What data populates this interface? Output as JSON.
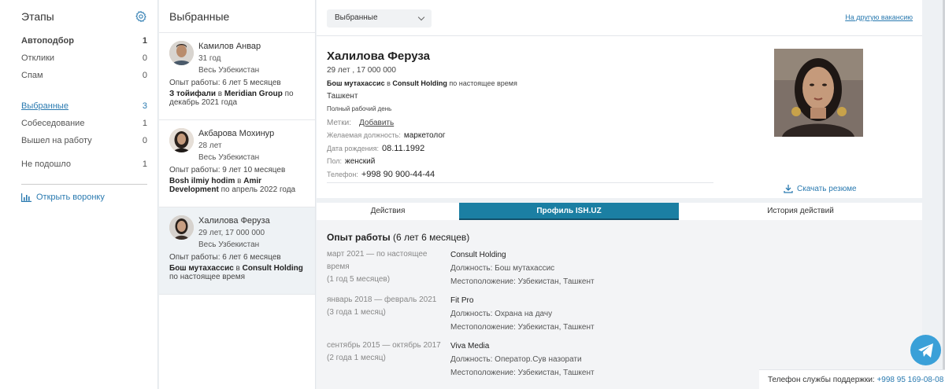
{
  "stages": {
    "title": "Этапы",
    "items": [
      {
        "label": "Автоподбор",
        "count": "1"
      },
      {
        "label": "Отклики",
        "count": "0"
      },
      {
        "label": "Спам",
        "count": "0"
      },
      {
        "label": "Выбранные",
        "count": "3"
      },
      {
        "label": "Собеседование",
        "count": "1"
      },
      {
        "label": "Вышел на работу",
        "count": "0"
      },
      {
        "label": "Не подошло",
        "count": "1"
      }
    ],
    "funnel_label": "Открыть воронку"
  },
  "selected": {
    "title": "Выбранные",
    "cards": [
      {
        "name": "Камилов Анвар",
        "age": "31 год",
        "region": "Весь Узбекистан",
        "exp": "Опыт работы: 6 лет 5 месяцев",
        "job_title": "З тойифали",
        "job_in": " в ",
        "job_company": "Meridian Group",
        "job_period": " по декабрь 2021 года"
      },
      {
        "name": "Акбарова Мохинур",
        "age": "28 лет",
        "region": "Весь Узбекистан",
        "exp": "Опыт работы: 9 лет 10 месяцев",
        "job_title": "Bosh ilmiy hodim",
        "job_in": " в ",
        "job_company": "Amir Development",
        "job_period": " по апрель 2022 года"
      },
      {
        "name": "Халилова Феруза",
        "age": "29 лет, 17 000 000",
        "region": "Весь Узбекистан",
        "exp": "Опыт работы: 6 лет 6 месяцев",
        "job_title": "Бош мутахассис",
        "job_in": " в ",
        "job_company": "Consult Holding",
        "job_period": " по настоящее время"
      }
    ]
  },
  "topbar": {
    "dropdown_value": "Выбранные",
    "other_vacancy": "На другую вакансию"
  },
  "profile": {
    "name": "Халилова Феруза",
    "meta": "29 лет , 17 000 000",
    "job_title": "Бош мутахассис",
    "job_in": " в ",
    "job_company": "Consult Holding",
    "job_period": " по настоящее время",
    "city": "Ташкент",
    "busy": "Полный рабочий день",
    "tags_label": "Метки:",
    "tags_add": "Добавить",
    "position_label": "Желаемая должность:",
    "position_value": "маркетолог",
    "birth_label": "Дата рождения:",
    "birth_value": "08.11.1992",
    "gender_label": "Пол:",
    "gender_value": "женский",
    "phone_label": "Телефон:",
    "phone_value": "+998 90 900-44-44",
    "download": "Скачать резюме"
  },
  "tabs": [
    "Действия",
    "Профиль ISH.UZ",
    "История действий"
  ],
  "experience": {
    "title": "Опыт работы",
    "total": " (6 лет 6 месяцев)",
    "entries": [
      {
        "period": "март 2021 — по настоящее время",
        "duration": "(1 год 5 месяцев)",
        "company": "Consult Holding",
        "position": "Должность: Бош мутахассис",
        "location": "Местоположение: Узбекистан, Ташкент"
      },
      {
        "period": "январь 2018 — февраль 2021",
        "duration": "(3 года 1 месяц)",
        "company": "Fit Pro",
        "position": "Должность: Охрана на дачу",
        "location": "Местоположение: Узбекистан, Ташкент"
      },
      {
        "period": "сентябрь 2015 — октябрь 2017",
        "duration": "(2 года 1 месяц)",
        "company": "Viva Media",
        "position": "Должность: Оператор.Сув назорати",
        "location": "Местоположение: Узбекистан, Ташкент"
      }
    ]
  },
  "support": {
    "label": "Телефон службы поддержки: ",
    "phone": "+998 95 169-08-08"
  }
}
